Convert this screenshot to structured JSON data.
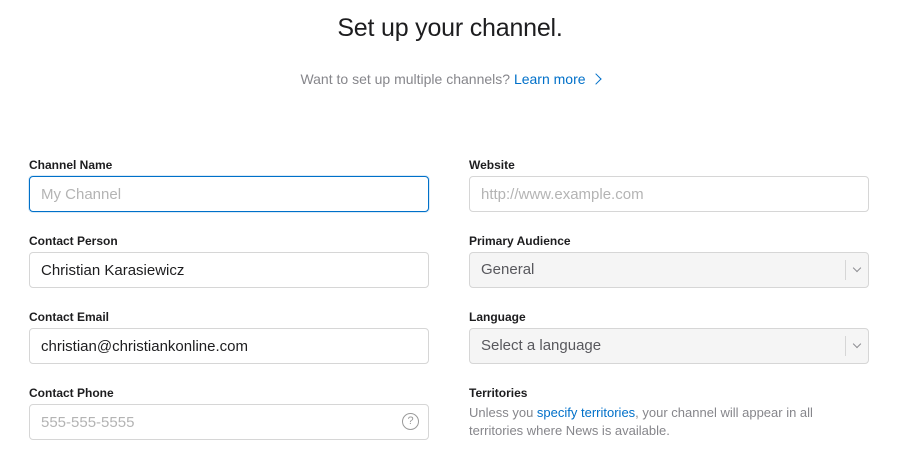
{
  "header": {
    "title": "Set up your channel.",
    "subtitle_text": "Want to set up multiple channels?",
    "learn_more_label": "Learn more"
  },
  "form": {
    "channel_name": {
      "label": "Channel Name",
      "placeholder": "My Channel",
      "value": ""
    },
    "website": {
      "label": "Website",
      "placeholder": "http://www.example.com",
      "value": ""
    },
    "contact_person": {
      "label": "Contact Person",
      "value": "Christian Karasiewicz"
    },
    "primary_audience": {
      "label": "Primary Audience",
      "selected": "General"
    },
    "contact_email": {
      "label": "Contact Email",
      "value": "christian@christiankonline.com"
    },
    "language": {
      "label": "Language",
      "selected": "Select a language"
    },
    "contact_phone": {
      "label": "Contact Phone",
      "placeholder": "555-555-5555",
      "value": "",
      "help_glyph": "?"
    },
    "territories": {
      "label": "Territories",
      "text_before": "Unless you ",
      "link_label": "specify territories",
      "text_after": ", your channel will appear in all territories where News is available."
    }
  },
  "colors": {
    "accent": "#0070c9",
    "muted_text": "#86868b",
    "border": "#d6d6d6",
    "select_bg": "#f5f5f5"
  },
  "icons": {
    "learn_more": "chevron-right-icon",
    "select": "chevron-down-icon",
    "help": "question-circle-icon"
  }
}
